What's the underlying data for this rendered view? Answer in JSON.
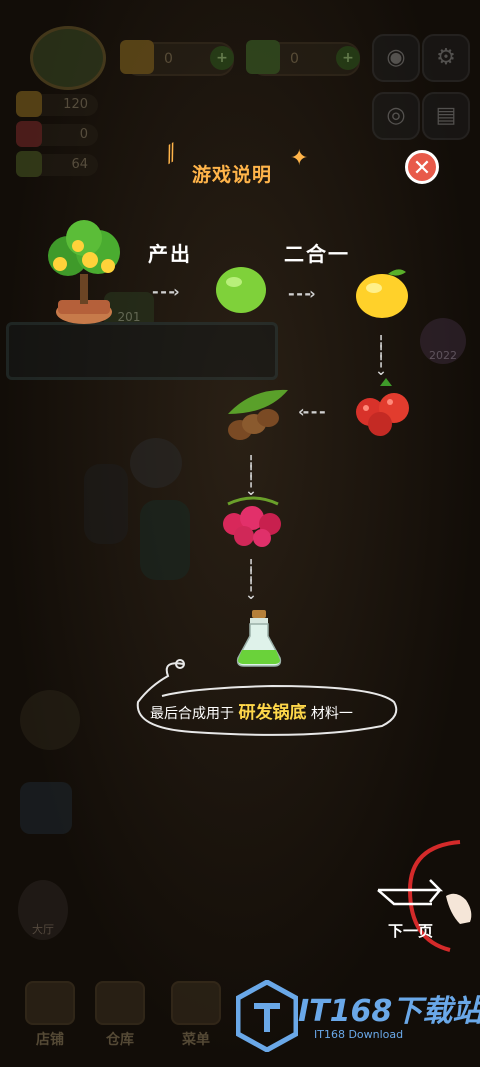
{
  "hud": {
    "currency_1": "0",
    "currency_2": "0",
    "stat_1": "120",
    "stat_2": "0",
    "stat_3": "64",
    "badge_year": "2022",
    "counter": "201"
  },
  "tutorial": {
    "title": "游戏说明",
    "label_produce": "产出",
    "label_merge": "二合一",
    "close_symbol": "✕",
    "final_prefix": "最后合成用于",
    "final_highlight": "研发锅底",
    "final_suffix": "材料一",
    "next_label": "下一页",
    "items": [
      "fruit-tree",
      "lime",
      "lemon",
      "red-berries",
      "tamarind",
      "raspberry-cluster",
      "green-potion"
    ]
  },
  "bottom_nav": [
    {
      "label": "店铺",
      "icon": "shop-icon"
    },
    {
      "label": "仓库",
      "icon": "warehouse-icon"
    },
    {
      "label": "菜单",
      "icon": "menu-icon"
    }
  ],
  "side": {
    "hall_label": "大厅"
  },
  "watermark": {
    "main": "IT168下载站",
    "sub": "IT168 Download"
  },
  "colors": {
    "title": "#ffb44a",
    "highlight": "#ffd84a",
    "close": "#e85a4a",
    "watermark": "#6aa8e8"
  }
}
